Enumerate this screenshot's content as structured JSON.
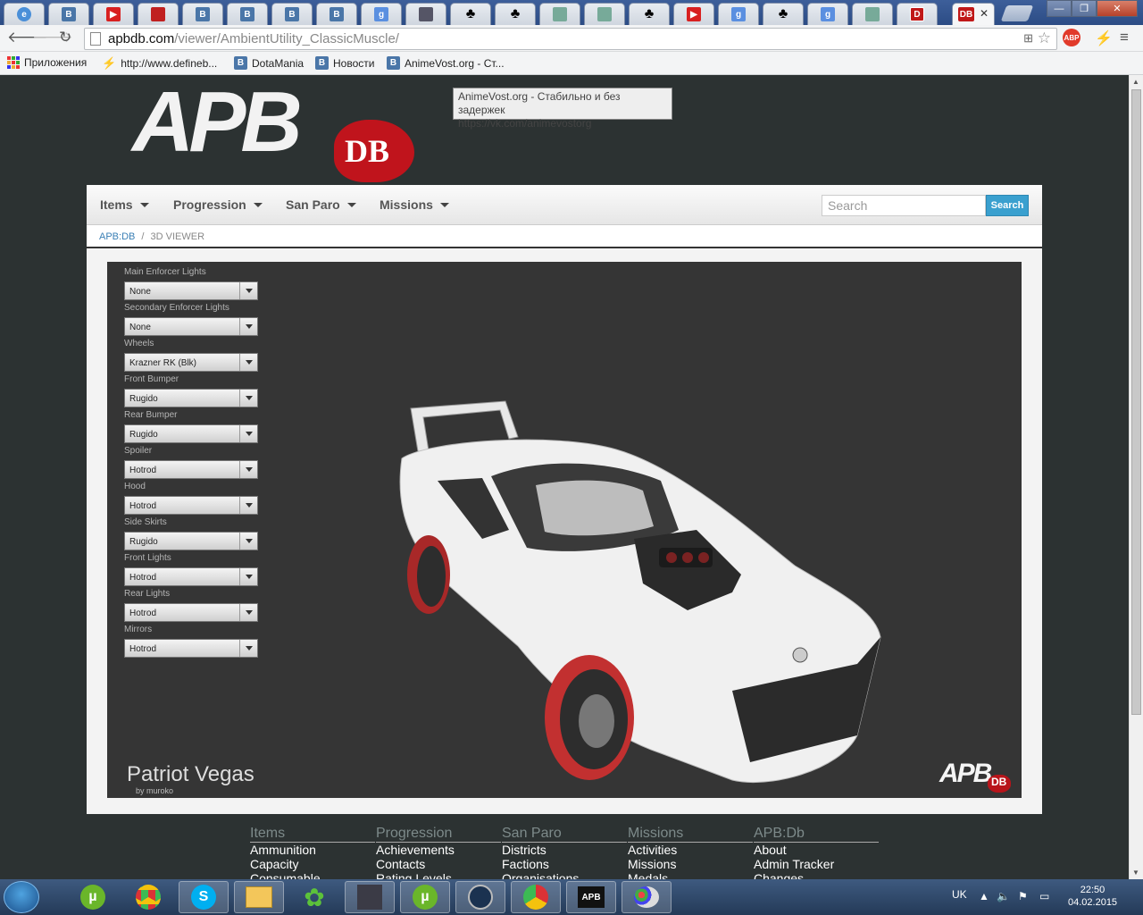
{
  "browser": {
    "active_tab_label": "DB",
    "url_host": "apbdb.com",
    "url_path": "/viewer/AmbientUtility_ClassicMuscle/",
    "bookmarks": [
      {
        "icon": "apps-grid-icon",
        "label": "Приложения"
      },
      {
        "icon": "bolt-icon",
        "label": "http://www.defineb..."
      },
      {
        "icon": "vk-icon",
        "label": "DotaMania"
      },
      {
        "icon": "vk-icon",
        "label": "Новости"
      },
      {
        "icon": "vk-icon",
        "label": "AnimeVost.org - Ст..."
      }
    ],
    "tooltip_line1": "AnimeVost.org - Стабильно и без задержек",
    "tooltip_line2": "https://vk.com/animevostorg"
  },
  "site": {
    "logo_main": "APB",
    "logo_sub": "DB",
    "nav": [
      {
        "label": "Items"
      },
      {
        "label": "Progression"
      },
      {
        "label": "San Paro"
      },
      {
        "label": "Missions"
      }
    ],
    "search_placeholder": "Search",
    "search_button": "Search",
    "breadcrumb_home": "APB:DB",
    "breadcrumb_sep": "/",
    "breadcrumb_current": "3D VIEWER"
  },
  "viewer": {
    "options": [
      {
        "label": "Main Enforcer Lights",
        "value": "None"
      },
      {
        "label": "Secondary Enforcer Lights",
        "value": "None"
      },
      {
        "label": "Wheels",
        "value": "Krazner RK (Blk)"
      },
      {
        "label": "Front Bumper",
        "value": "Rugido"
      },
      {
        "label": "Rear Bumper",
        "value": "Rugido"
      },
      {
        "label": "Spoiler",
        "value": "Hotrod"
      },
      {
        "label": "Hood",
        "value": "Hotrod"
      },
      {
        "label": "Side Skirts",
        "value": "Rugido"
      },
      {
        "label": "Front Lights",
        "value": "Hotrod"
      },
      {
        "label": "Rear Lights",
        "value": "Hotrod"
      },
      {
        "label": "Mirrors",
        "value": "Hotrod"
      }
    ],
    "car_name": "Patriot Vegas",
    "car_author": "by muroko",
    "watermark_main": "APB",
    "watermark_sub": "DB"
  },
  "footer": {
    "columns": [
      {
        "heading": "Items",
        "links": [
          "Ammunition",
          "Capacity",
          "Consumable"
        ]
      },
      {
        "heading": "Progression",
        "links": [
          "Achievements",
          "Contacts",
          "Rating Levels"
        ]
      },
      {
        "heading": "San Paro",
        "links": [
          "Districts",
          "Factions",
          "Organisations"
        ]
      },
      {
        "heading": "Missions",
        "links": [
          "Activities",
          "Missions",
          "Medals"
        ]
      },
      {
        "heading": "APB:Db",
        "links": [
          "About",
          "Admin Tracker",
          "Changes"
        ]
      }
    ]
  },
  "taskbar": {
    "language": "UK",
    "time": "22:50",
    "date": "04.02.2015"
  },
  "colors": {
    "accent_blue": "#3aa0cf",
    "page_bg": "#2c3232",
    "logo_red": "#c0141c"
  }
}
